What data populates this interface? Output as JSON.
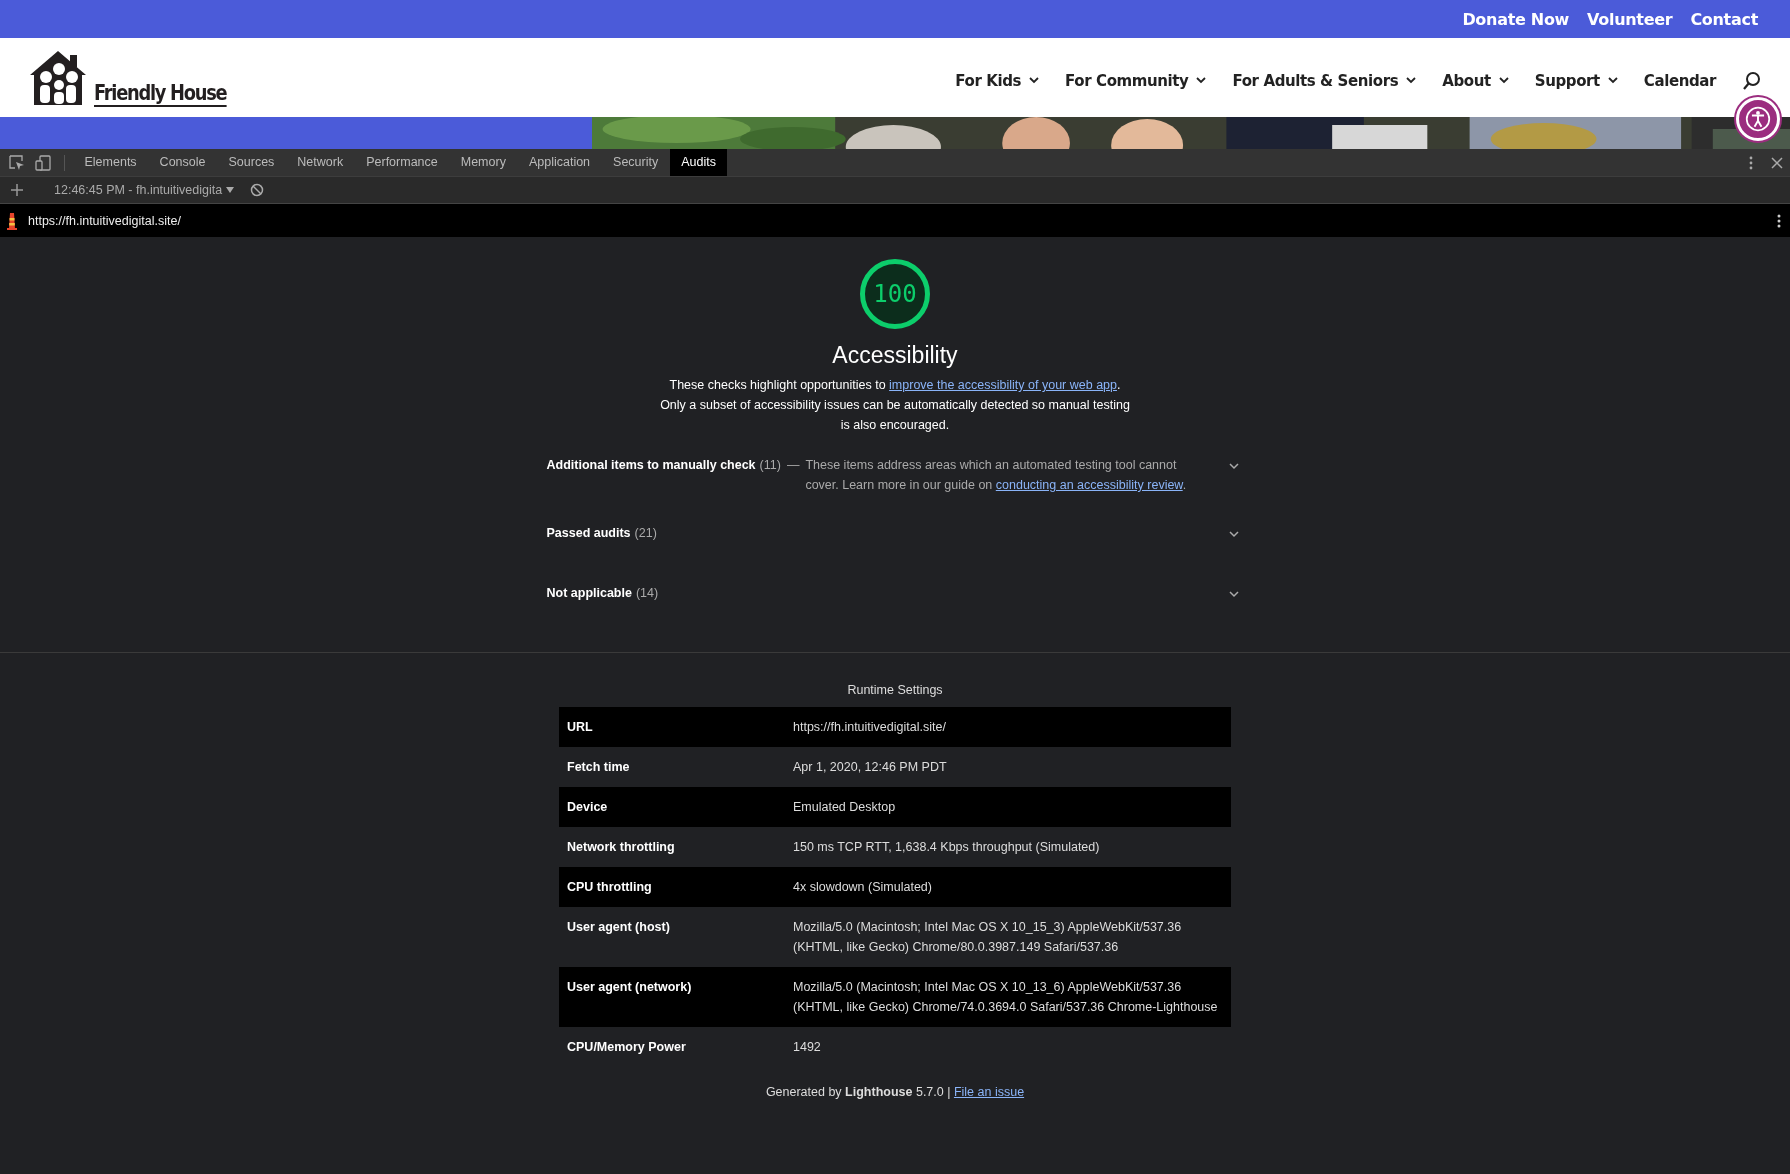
{
  "site": {
    "top_links": [
      "Donate Now",
      "Volunteer",
      "Contact"
    ],
    "logo_text": "Friendly House",
    "nav": [
      {
        "label": "For Kids",
        "dropdown": true
      },
      {
        "label": "For Community",
        "dropdown": true
      },
      {
        "label": "For Adults & Seniors",
        "dropdown": true
      },
      {
        "label": "About",
        "dropdown": true
      },
      {
        "label": "Support",
        "dropdown": true
      },
      {
        "label": "Calendar",
        "dropdown": false
      }
    ]
  },
  "devtools": {
    "tabs": [
      {
        "label": "Elements",
        "selected": false
      },
      {
        "label": "Console",
        "selected": false
      },
      {
        "label": "Sources",
        "selected": false
      },
      {
        "label": "Network",
        "selected": false
      },
      {
        "label": "Performance",
        "selected": false
      },
      {
        "label": "Memory",
        "selected": false
      },
      {
        "label": "Application",
        "selected": false
      },
      {
        "label": "Security",
        "selected": false
      },
      {
        "label": "Audits",
        "selected": true
      }
    ],
    "session": "12:46:45 PM - fh.intuitivedigita",
    "url": "https://fh.intuitivedigital.site/"
  },
  "report": {
    "score": "100",
    "title": "Accessibility",
    "description": {
      "before": "These checks highlight opportunities to ",
      "link": "improve the accessibility of your web app",
      "after": ". Only a subset of accessibility issues can be automatically detected so manual testing is also encouraged."
    },
    "groups": [
      {
        "title": "Additional items to manually check",
        "count": "(11)",
        "separator": "—",
        "description": {
          "before": "These items address areas which an automated testing tool cannot cover. Learn more in our guide on ",
          "link": "conducting an accessibility review",
          "after": "."
        }
      },
      {
        "title": "Passed audits",
        "count": "(21)"
      },
      {
        "title": "Not applicable",
        "count": "(14)"
      }
    ],
    "runtime": {
      "heading": "Runtime Settings",
      "rows": [
        {
          "label": "URL",
          "value": "https://fh.intuitivedigital.site/"
        },
        {
          "label": "Fetch time",
          "value": "Apr 1, 2020, 12:46 PM PDT"
        },
        {
          "label": "Device",
          "value": "Emulated Desktop"
        },
        {
          "label": "Network throttling",
          "value": "150 ms TCP RTT, 1,638.4 Kbps throughput (Simulated)"
        },
        {
          "label": "CPU throttling",
          "value": "4x slowdown (Simulated)"
        },
        {
          "label": "User agent (host)",
          "value": "Mozilla/5.0 (Macintosh; Intel Mac OS X 10_15_3) AppleWebKit/537.36 (KHTML, like Gecko) Chrome/80.0.3987.149 Safari/537.36"
        },
        {
          "label": "User agent (network)",
          "value": "Mozilla/5.0 (Macintosh; Intel Mac OS X 10_13_6) AppleWebKit/537.36 (KHTML, like Gecko) Chrome/74.0.3694.0 Safari/537.36 Chrome-Lighthouse"
        },
        {
          "label": "CPU/Memory Power",
          "value": "1492"
        }
      ]
    },
    "footer": {
      "text": "Generated by **Lighthouse** 5.7.0 | ",
      "link": "File an issue"
    }
  }
}
